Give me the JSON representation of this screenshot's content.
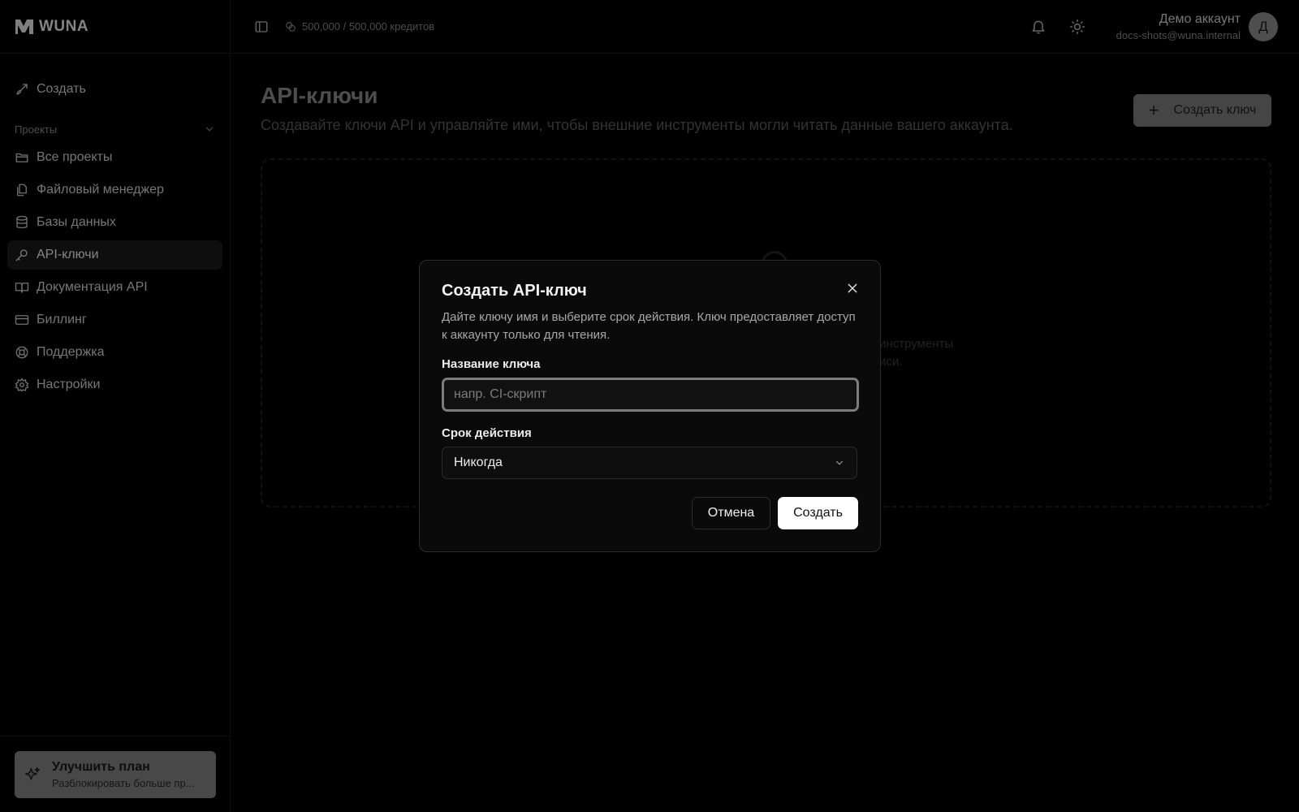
{
  "brand": {
    "name": "WUNA"
  },
  "sidebar": {
    "create": "Создать",
    "section_projects": "Проекты",
    "items": [
      {
        "label": "Все проекты",
        "icon": "folder-icon"
      },
      {
        "label": "Файловый менеджер",
        "icon": "files-icon"
      },
      {
        "label": "Базы данных",
        "icon": "database-icon"
      },
      {
        "label": "API-ключи",
        "icon": "key-icon",
        "active": true
      },
      {
        "label": "Документация API",
        "icon": "book-icon"
      },
      {
        "label": "Биллинг",
        "icon": "credit-card-icon"
      },
      {
        "label": "Поддержка",
        "icon": "lifebuoy-icon"
      },
      {
        "label": "Настройки",
        "icon": "gear-icon"
      }
    ],
    "upgrade": {
      "title": "Улучшить план",
      "subtitle": "Разблокировать больше пр..."
    }
  },
  "topbar": {
    "credits": "500,000 / 500,000 кредитов",
    "user_name": "Демо аккаунт",
    "user_email": "docs-shots@wuna.internal",
    "avatar_letter": "Д"
  },
  "page": {
    "title": "API-ключи",
    "subtitle": "Создавайте ключи API и управляйте ими, чтобы внешние инструменты могли читать данные вашего аккаунта.",
    "create_button": "Создать ключ",
    "empty_line1": "инструменты",
    "empty_line2": "иси."
  },
  "dialog": {
    "title": "Создать API-ключ",
    "description": "Дайте ключу имя и выберите срок действия. Ключ предоставляет доступ к аккаунту только для чтения.",
    "name_label": "Название ключа",
    "name_placeholder": "напр. CI-скрипт",
    "name_value": "",
    "expiry_label": "Срок действия",
    "expiry_value": "Никогда",
    "cancel": "Отмена",
    "submit": "Создать"
  }
}
